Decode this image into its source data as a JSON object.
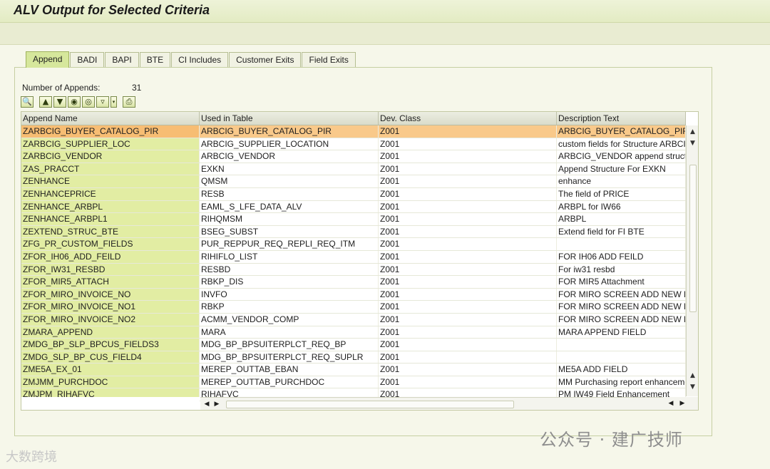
{
  "title": "ALV Output for Selected Criteria",
  "tabs": [
    "Append",
    "BADI",
    "BAPI",
    "BTE",
    "CI Includes",
    "Customer Exits",
    "Field Exits"
  ],
  "summary": {
    "label": "Number of Appends:",
    "value": "31"
  },
  "columns": [
    "Append Name",
    "Used in Table",
    "Dev. Class",
    "Description Text"
  ],
  "rows": [
    [
      "ZARBCIG_BUYER_CATALOG_PIR",
      "ARBCIG_BUYER_CATALOG_PIR",
      "Z001",
      "ARBCIG_BUYER_CATALOG_PIR a"
    ],
    [
      "ZARBCIG_SUPPLIER_LOC",
      "ARBCIG_SUPPLIER_LOCATION",
      "Z001",
      "custom fields for Structure ARBCI"
    ],
    [
      "ZARBCIG_VENDOR",
      "ARBCIG_VENDOR",
      "Z001",
      "ARBCIG_VENDOR append structu"
    ],
    [
      "ZAS_PRACCT",
      "EXKN",
      "Z001",
      "Append Structure For EXKN"
    ],
    [
      "ZENHANCE",
      "QMSM",
      "Z001",
      "enhance"
    ],
    [
      "ZENHANCEPRICE",
      "RESB",
      "Z001",
      "The field of PRICE"
    ],
    [
      "ZENHANCE_ARBPL",
      "EAML_S_LFE_DATA_ALV",
      "Z001",
      "ARBPL for IW66"
    ],
    [
      "ZENHANCE_ARBPL1",
      "RIHQMSM",
      "Z001",
      "ARBPL"
    ],
    [
      "ZEXTEND_STRUC_BTE",
      "BSEG_SUBST",
      "Z001",
      "Extend field for FI BTE"
    ],
    [
      "ZFG_PR_CUSTOM_FIELDS",
      "PUR_REPPUR_REQ_REPLI_REQ_ITM",
      "Z001",
      ""
    ],
    [
      "ZFOR_IH06_ADD_FEILD",
      "RIHIFLO_LIST",
      "Z001",
      "FOR IH06 ADD FEILD"
    ],
    [
      "ZFOR_IW31_RESBD",
      "RESBD",
      "Z001",
      "For iw31 resbd"
    ],
    [
      "ZFOR_MIR5_ATTACH",
      "RBKP_DIS",
      "Z001",
      "FOR MIR5 Attachment"
    ],
    [
      "ZFOR_MIRO_INVOICE_NO",
      "INVFO",
      "Z001",
      "FOR MIRO SCREEN ADD NEW FIE"
    ],
    [
      "ZFOR_MIRO_INVOICE_NO1",
      "RBKP",
      "Z001",
      "FOR MIRO SCREEN ADD NEW FIE"
    ],
    [
      "ZFOR_MIRO_INVOICE_NO2",
      "ACMM_VENDOR_COMP",
      "Z001",
      "FOR MIRO SCREEN ADD NEW FIE"
    ],
    [
      "ZMARA_APPEND",
      "MARA",
      "Z001",
      "MARA APPEND FIELD"
    ],
    [
      "ZMDG_BP_SLP_BPCUS_FIELDS3",
      "MDG_BP_BPSUITERPLCT_REQ_BP",
      "Z001",
      ""
    ],
    [
      "ZMDG_SLP_BP_CUS_FIELD4",
      "MDG_BP_BPSUITERPLCT_REQ_SUPLR",
      "Z001",
      ""
    ],
    [
      "ZME5A_EX_01",
      "MEREP_OUTTAB_EBAN",
      "Z001",
      "ME5A ADD FIELD"
    ],
    [
      "ZMJMM_PURCHDOC",
      "MEREP_OUTTAB_PURCHDOC",
      "Z001",
      "MM Purchasing report enhanceme"
    ],
    [
      "ZMJPM_RIHAFVC",
      "RIHAFVC",
      "Z001",
      "PM IW49 Field Enhancement"
    ]
  ],
  "selected_row": 0,
  "watermark_right": "公众号 · 建广技师",
  "watermark_left": "大数跨境",
  "colors": {
    "header_band": "#e3ebc3",
    "active_tab": "#d6e79c",
    "key_column": "#e2eda3",
    "selected_row": "#f9c98a"
  }
}
